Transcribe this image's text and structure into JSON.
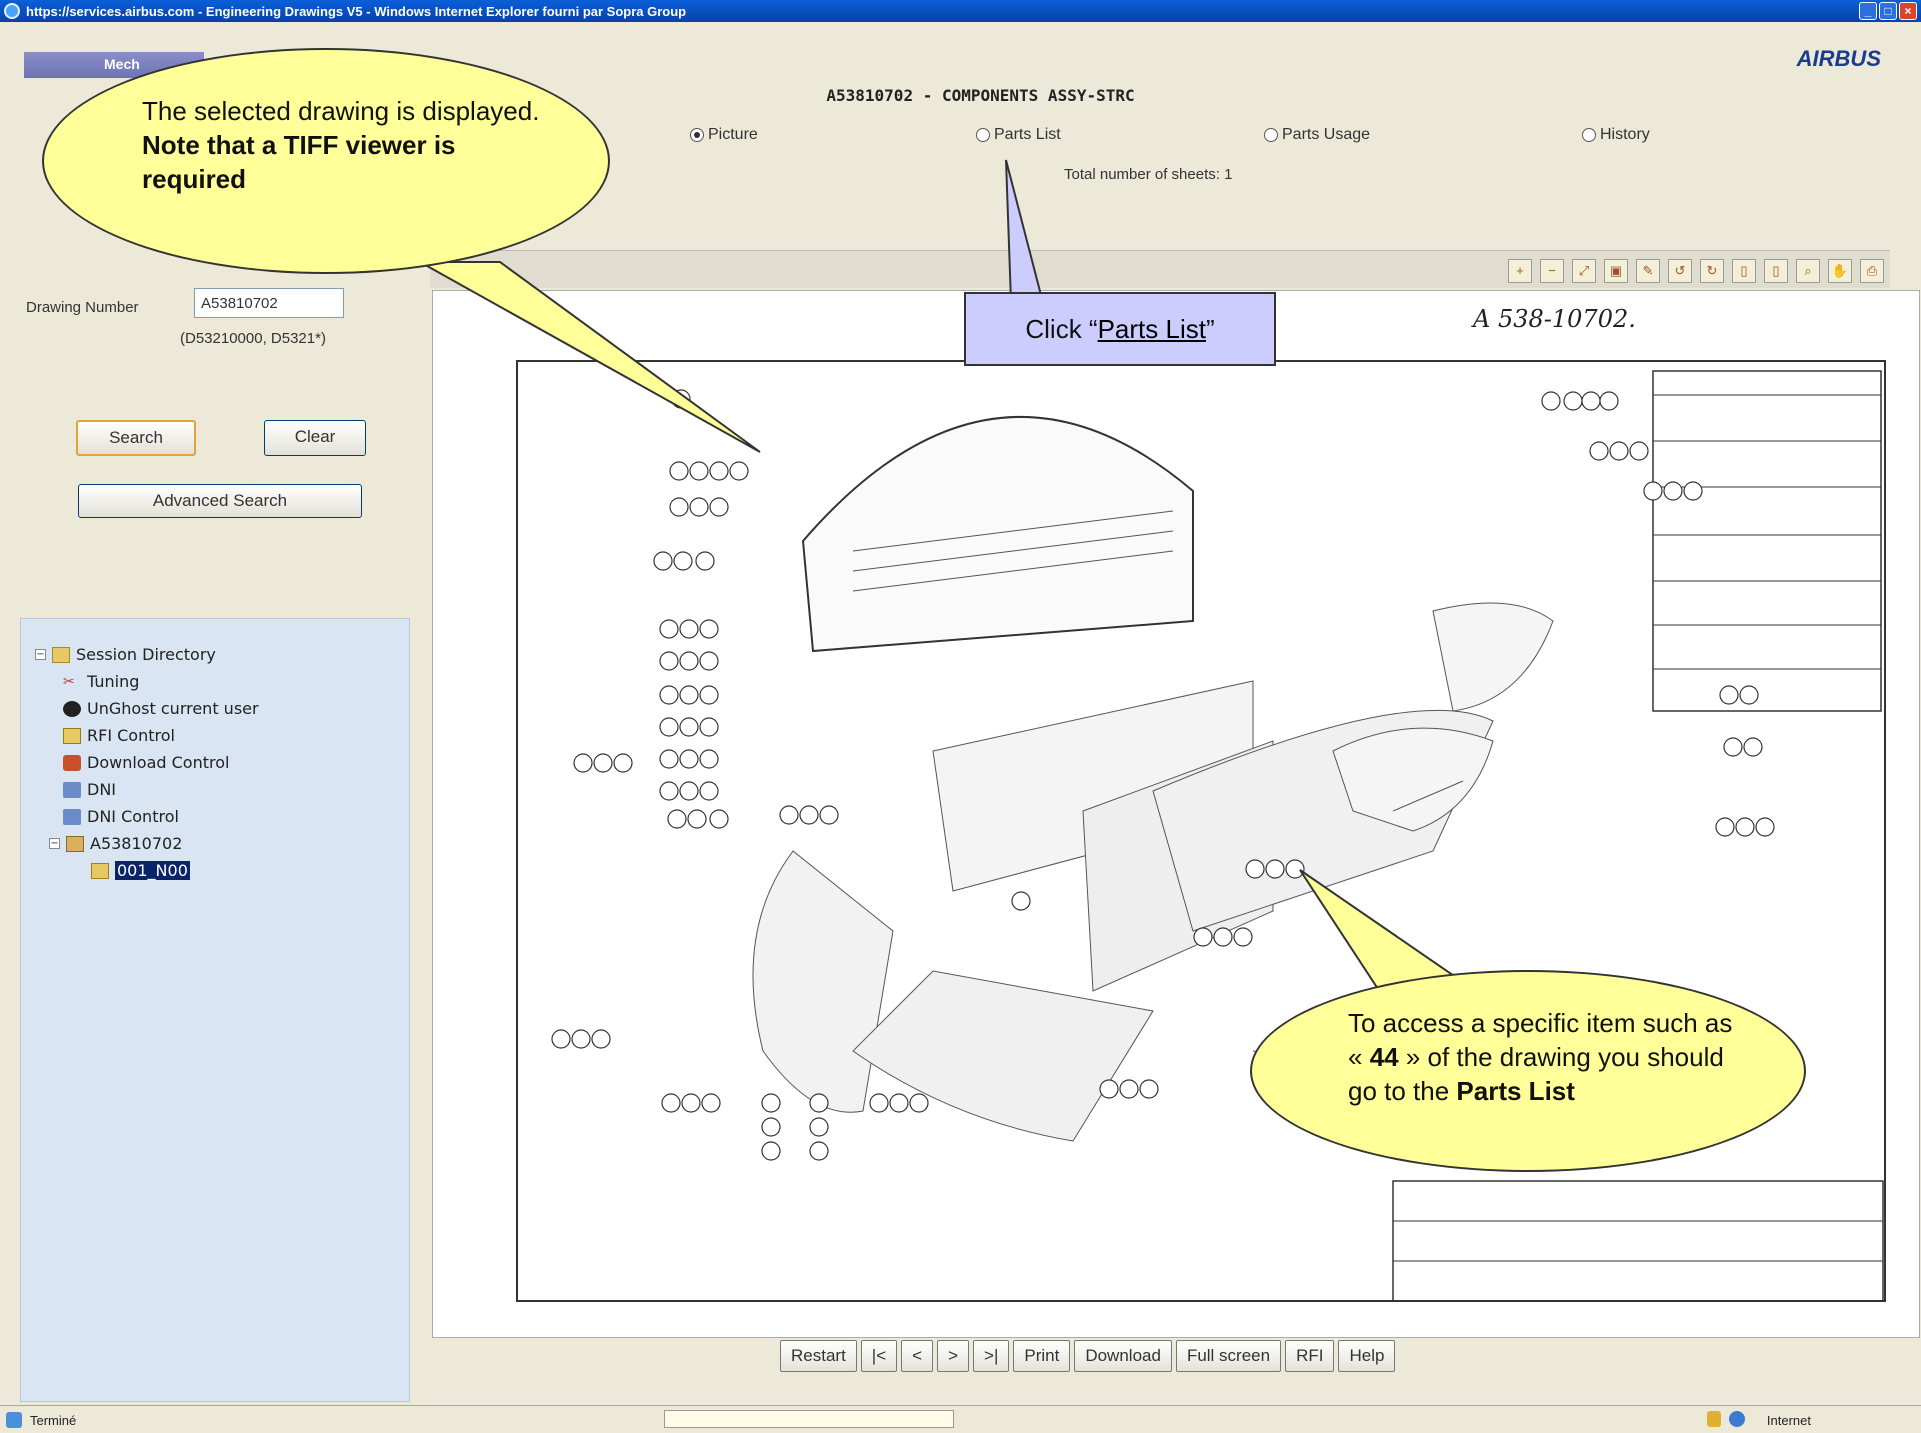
{
  "window": {
    "title": "https://services.airbus.com - Engineering Drawings V5 - Windows Internet Explorer fourni par Sopra Group"
  },
  "header": {
    "tab_label": "Mech",
    "brand": "AIRBUS",
    "drawing_title": "A53810702 - COMPONENTS ASSY-STRC",
    "views": [
      {
        "label": "Picture",
        "selected": true
      },
      {
        "label": "Parts List",
        "selected": false
      },
      {
        "label": "Parts Usage",
        "selected": false
      },
      {
        "label": "History",
        "selected": false
      }
    ],
    "sheets_text": "Total number of sheets: 1"
  },
  "toolbar": {
    "icons": [
      "zoom-in-icon",
      "zoom-out-icon",
      "zoom-fit-icon",
      "select-area-icon",
      "annotate-icon",
      "rotate-left-icon",
      "rotate-right-icon",
      "page-icon",
      "page-alt-icon",
      "magnify-icon",
      "pan-hand-icon",
      "print-icon"
    ]
  },
  "search": {
    "drawing_number_label": "Drawing Number",
    "drawing_number_value": "A53810702",
    "hint": "(D53210000, D5321*)",
    "search_label": "Search",
    "clear_label": "Clear",
    "advanced_label": "Advanced Search"
  },
  "tree": {
    "root": "Session Directory",
    "items": [
      {
        "label": "Tuning",
        "icon": "tuning-icon"
      },
      {
        "label": "UnGhost current user",
        "icon": "user-icon"
      },
      {
        "label": "RFI Control",
        "icon": "mail-icon"
      },
      {
        "label": "Download Control",
        "icon": "download-icon"
      },
      {
        "label": "DNI",
        "icon": "dni-icon"
      },
      {
        "label": "DNI Control",
        "icon": "dni-icon"
      }
    ],
    "drawing_node": "A53810702",
    "sheet_node": "001_N00"
  },
  "viewer": {
    "handwritten_ref": "A 538-10702."
  },
  "nav": {
    "buttons": [
      "Restart",
      "|<",
      "<",
      ">",
      ">|",
      "Print",
      "Download",
      "Full screen",
      "RFI",
      "Help"
    ]
  },
  "status": {
    "left": "Terminé",
    "zone": "Internet"
  },
  "callouts": {
    "selected_line1": "The selected drawing is displayed.",
    "selected_line2": "Note that a TIFF viewer is required",
    "click_prefix": "Click “",
    "click_link": "Parts List",
    "click_suffix": "”",
    "access_prefix": "To access a specific item such as « ",
    "access_item": "44",
    "access_middle": " » of the drawing you should go to the ",
    "access_bold": "Parts List"
  }
}
